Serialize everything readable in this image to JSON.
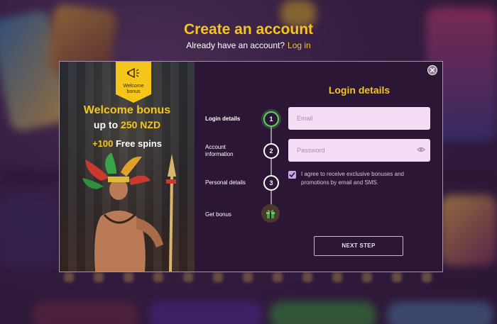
{
  "header": {
    "title": "Create an account",
    "have_account_text": "Already have an account?",
    "login_link": "Log in"
  },
  "promo": {
    "flag_label_line1": "Welcome",
    "flag_label_line2": "bonus",
    "title": "Welcome bonus",
    "amount_prefix": "up to",
    "amount_value": "250 NZD",
    "spins_value": "+100",
    "spins_label": "Free spins"
  },
  "steps": [
    {
      "number": "1",
      "label": "Login details",
      "active": true
    },
    {
      "number": "2",
      "label_line1": "Account",
      "label_line2": "information"
    },
    {
      "number": "3",
      "label": "Personal details"
    },
    {
      "label": "Get bonus",
      "icon": "gift-icon"
    }
  ],
  "form": {
    "title": "Login details",
    "email_placeholder": "Email",
    "password_placeholder": "Password",
    "consent_text": "I agree to receive exclusive bonuses and promotions by email and SMS.",
    "consent_checked": true,
    "next_label": "NEXT STEP"
  },
  "colors": {
    "accent": "#f5c51a",
    "active_step": "#5fd35d",
    "input_bg": "#f7dcf5",
    "modal_bg": "#2b1636"
  }
}
